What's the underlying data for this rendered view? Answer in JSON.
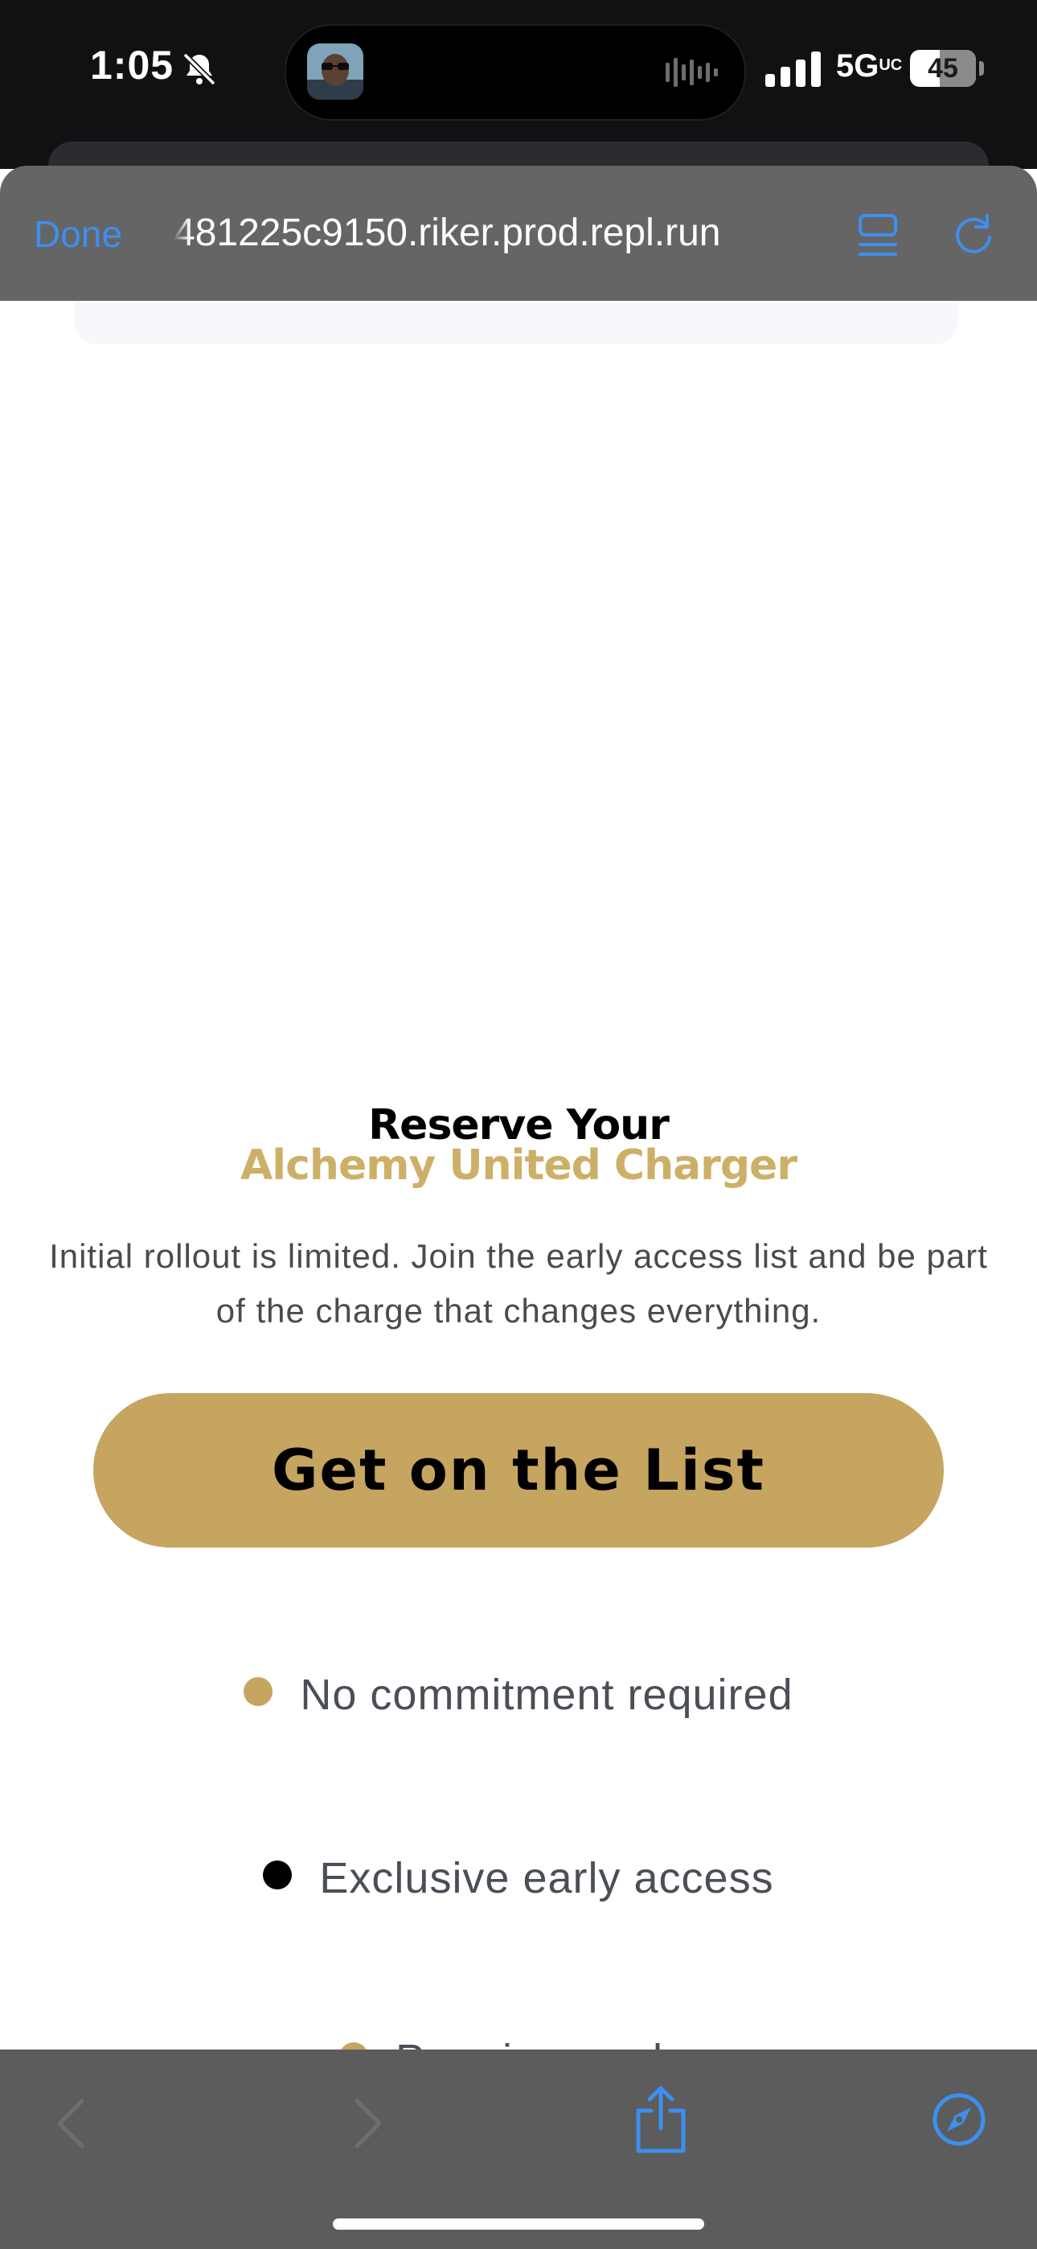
{
  "status_bar": {
    "time": "1:05",
    "network": "5G",
    "network_suffix": "UC",
    "battery_level": "45",
    "battery_percent": 45,
    "icons": [
      "bell-slash-icon",
      "signal-bars-icon",
      "audio-wave-icon"
    ]
  },
  "browser": {
    "done_label": "Done",
    "url": "481225c9150.riker.prod.repl.run",
    "icons": [
      "reader-icon",
      "reload-icon",
      "back-icon",
      "forward-icon",
      "share-icon",
      "compass-icon"
    ],
    "accent_color": "#3d8ff0"
  },
  "hero": {
    "title_line1": "Reserve Your",
    "title_line2": "Alchemy United Charger",
    "subtitle": "Initial rollout is limited. Join the early access list and be part of the charge that changes everything.",
    "cta_label": "Get on the List",
    "brand_color": "#c6a560"
  },
  "features": [
    {
      "label": "No commitment required",
      "dot_color": "#c6a560"
    },
    {
      "label": "Exclusive early access",
      "dot_color": "#000000"
    },
    {
      "label": "Premium perks",
      "dot_color": "#c6a560"
    }
  ]
}
